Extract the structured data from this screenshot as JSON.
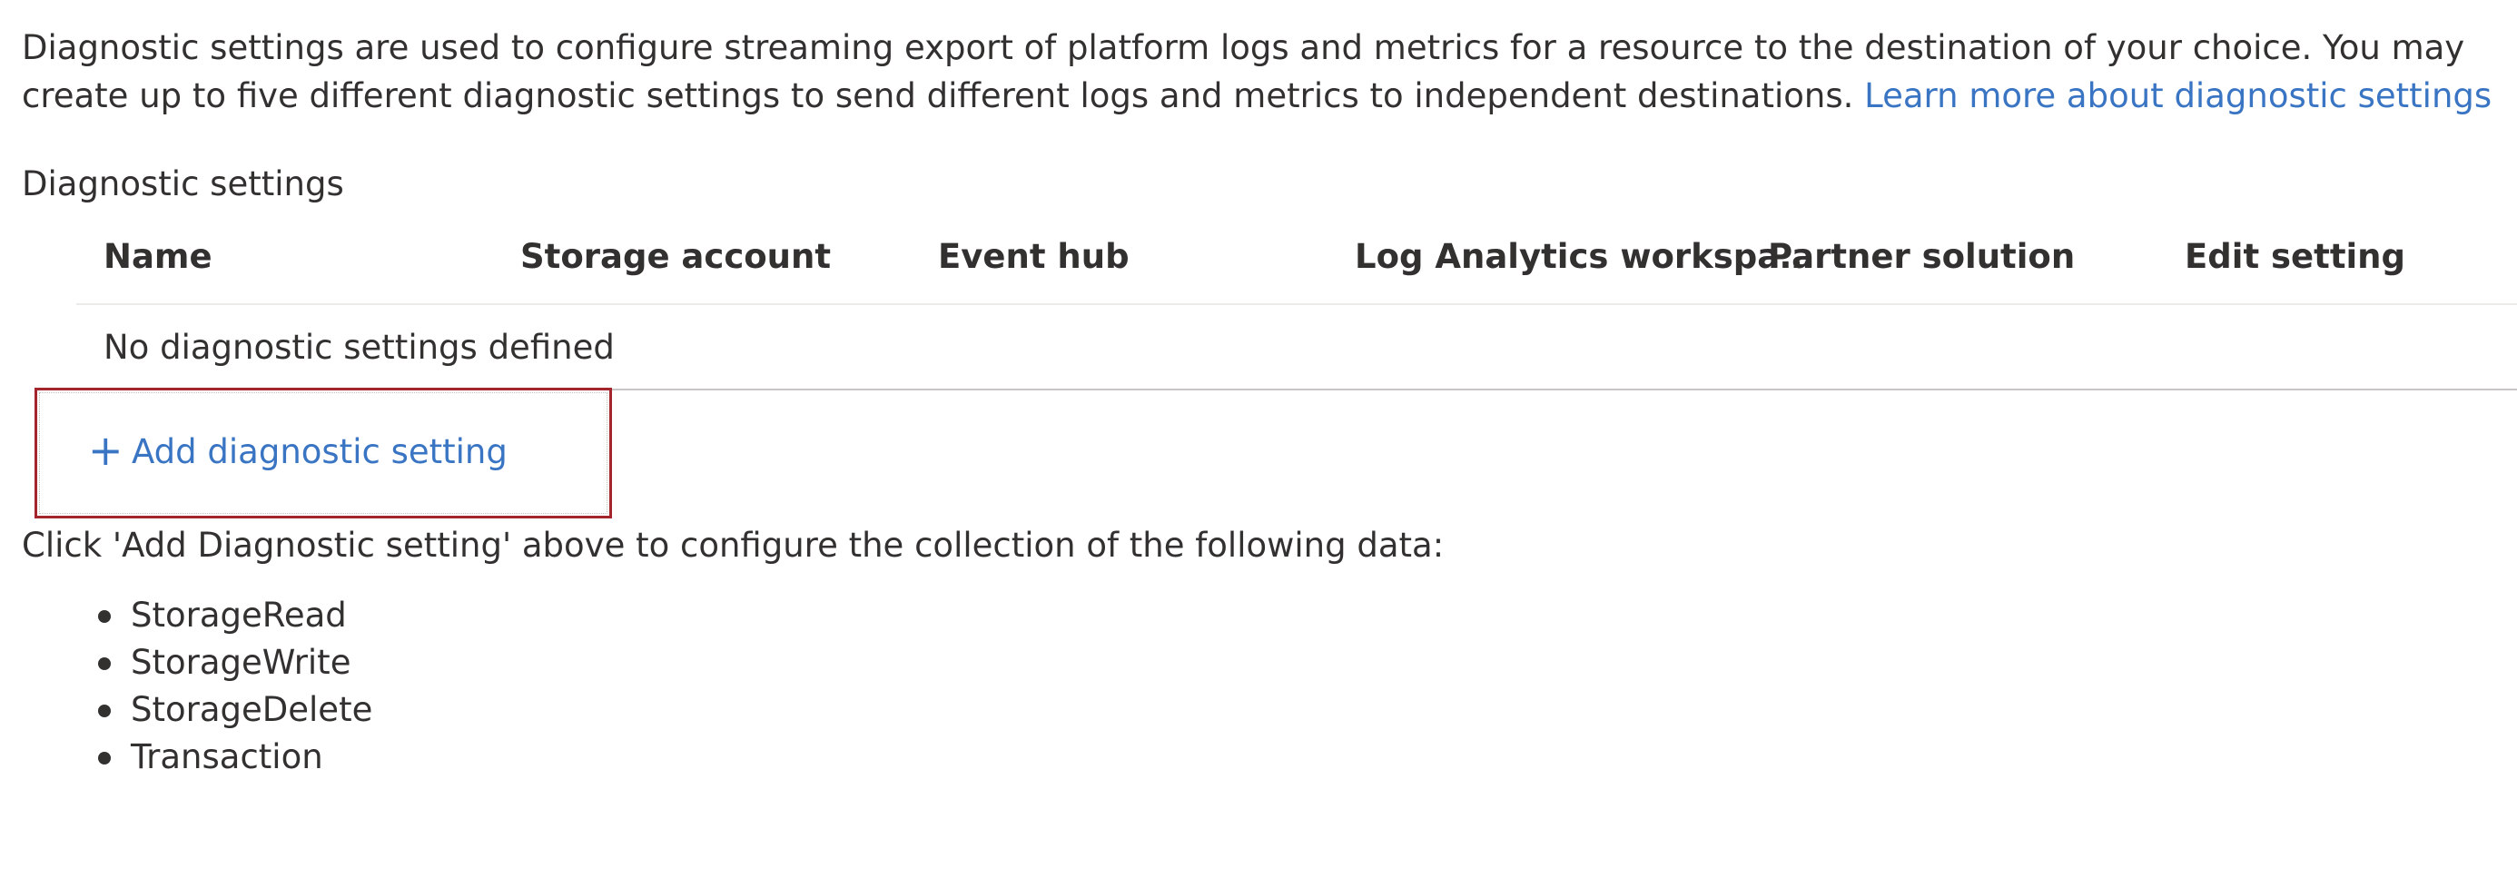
{
  "intro": {
    "text": "Diagnostic settings are used to configure streaming export of platform logs and metrics for a resource to the destination of your choice. You may create up to five different diagnostic settings to send different logs and metrics to independent destinations.",
    "link_text": "Learn more about diagnostic settings"
  },
  "section_label": "Diagnostic settings",
  "table": {
    "columns": [
      "Name",
      "Storage account",
      "Event hub",
      "Log Analytics workspa...",
      "Partner solution",
      "Edit setting"
    ],
    "empty_message": "No diagnostic settings defined"
  },
  "add_button": {
    "icon": "plus-icon",
    "label": "Add diagnostic setting",
    "highlight_color": "#a4262c"
  },
  "click_note": "Click 'Add Diagnostic setting' above to configure the collection of the following data:",
  "data_items": [
    "StorageRead",
    "StorageWrite",
    "StorageDelete",
    "Transaction"
  ],
  "colors": {
    "link": "#3a75c4",
    "text": "#323130"
  }
}
